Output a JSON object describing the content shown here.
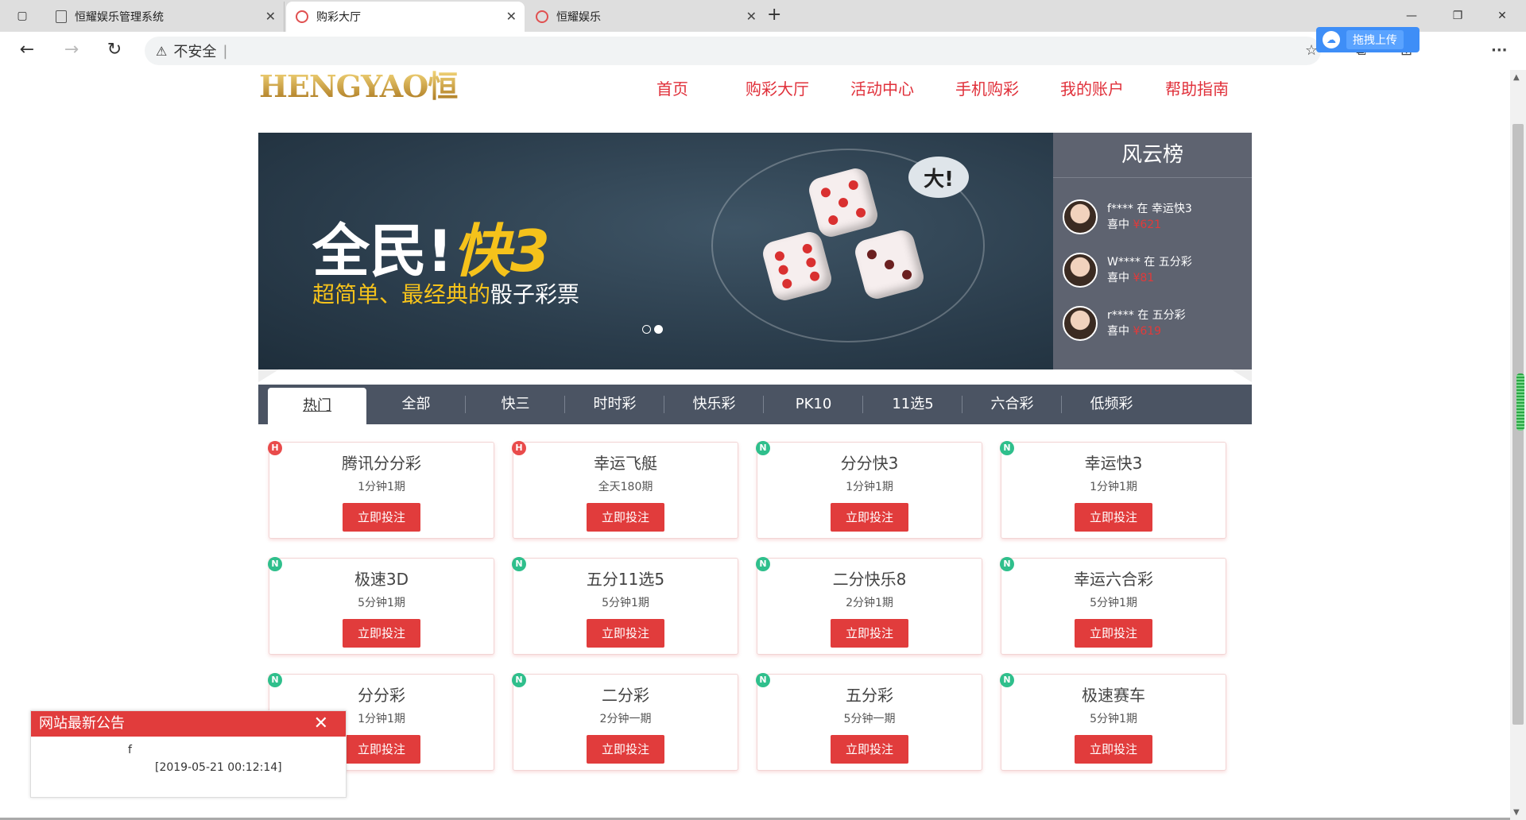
{
  "browser": {
    "tabs": [
      {
        "title": "恒耀娱乐管理系统",
        "active": false
      },
      {
        "title": "购彩大厅",
        "active": true
      },
      {
        "title": "恒耀娱乐",
        "active": false
      }
    ],
    "security_label": "不安全",
    "url": "",
    "baidu_upload_label": "拖拽上传"
  },
  "site": {
    "logo_text": "HENGYAO恒耀",
    "nav": [
      "首页",
      "购彩大厅",
      "活动中心",
      "手机购彩",
      "我的账户",
      "帮助指南"
    ]
  },
  "banner": {
    "headline_a": "全民!",
    "headline_b": "快3",
    "sub_a": "超简单、最经典的",
    "sub_b": "骰子彩票",
    "bubble": "大!",
    "active_slide": 2,
    "slide_count": 2
  },
  "leaderboard": {
    "title": "风云榜",
    "winners": [
      {
        "line1": "f**** 在 幸运快3",
        "prefix": "喜中",
        "amount": "¥621"
      },
      {
        "line1": "W**** 在 五分彩",
        "prefix": "喜中",
        "amount": "¥81"
      },
      {
        "line1": "r**** 在 五分彩",
        "prefix": "喜中",
        "amount": "¥619"
      }
    ]
  },
  "categories": [
    "热门",
    "全部",
    "快三",
    "时时彩",
    "快乐彩",
    "PK10",
    "11选5",
    "六合彩",
    "低频彩"
  ],
  "active_category": "热门",
  "bet_label": "立即投注",
  "games": [
    {
      "name": "腾讯分分彩",
      "period": "1分钟1期",
      "badge": "H"
    },
    {
      "name": "幸运飞艇",
      "period": "全天180期",
      "badge": "H"
    },
    {
      "name": "分分快3",
      "period": "1分钟1期",
      "badge": "N"
    },
    {
      "name": "幸运快3",
      "period": "1分钟1期",
      "badge": "N"
    },
    {
      "name": "极速3D",
      "period": "5分钟1期",
      "badge": "N"
    },
    {
      "name": "五分11选5",
      "period": "5分钟1期",
      "badge": "N"
    },
    {
      "name": "二分快乐8",
      "period": "2分钟1期",
      "badge": "N"
    },
    {
      "name": "幸运六合彩",
      "period": "5分钟1期",
      "badge": "N"
    },
    {
      "name": "分分彩",
      "period": "1分钟1期",
      "badge": "N"
    },
    {
      "name": "二分彩",
      "period": "2分钟一期",
      "badge": "N"
    },
    {
      "name": "五分彩",
      "period": "5分钟一期",
      "badge": "N"
    },
    {
      "name": "极速赛车",
      "period": "5分钟1期",
      "badge": "N"
    }
  ],
  "notice": {
    "title": "网站最新公告",
    "text": "f",
    "date": "[2019-05-21 00:12:14]"
  },
  "colors": {
    "brand_red": "#e13c3c",
    "nav_red": "#e0303a",
    "category_bar": "#4b5463",
    "leaderboard_bg": "#5e6370"
  }
}
